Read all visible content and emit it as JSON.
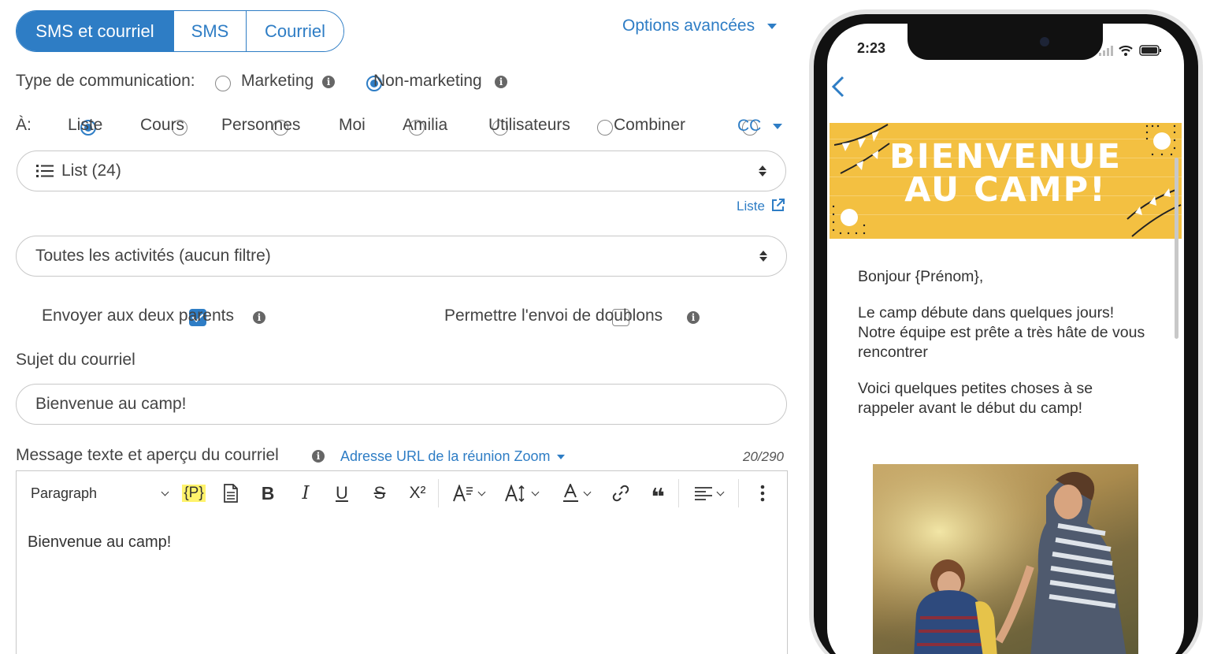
{
  "tabs": [
    "SMS et courriel",
    "SMS",
    "Courriel"
  ],
  "advanced_options_label": "Options avancées",
  "comm_type": {
    "label": "Type de communication:",
    "options": [
      "Marketing",
      "Non-marketing"
    ],
    "selected": "Non-marketing"
  },
  "recipients": {
    "label": "À:",
    "options": [
      "Liste",
      "Cours",
      "Personnes",
      "Moi",
      "Amilia",
      "Utilisateurs",
      "Combiner"
    ],
    "selected": "Liste",
    "cc_label": "CC"
  },
  "list_select": {
    "value": "List (24)"
  },
  "list_link_label": "Liste",
  "activity_select": {
    "value": "Toutes les activités (aucun filtre)"
  },
  "send_both_parents": {
    "label": "Envoyer aux deux parents",
    "checked": true
  },
  "allow_duplicates": {
    "label": "Permettre l'envoi de doublons",
    "checked": false
  },
  "subject": {
    "label": "Sujet du courriel",
    "value": "Bienvenue au camp!"
  },
  "message": {
    "label": "Message texte et aperçu du courriel",
    "zoom_link_label": "Adresse URL de la réunion Zoom",
    "counter": "20/290",
    "body": "Bienvenue au camp!"
  },
  "toolbar": {
    "paragraph_label": "Paragraph",
    "placeholder_token": "{P}",
    "bold": "B",
    "italic": "I",
    "underline": "U",
    "strike": "S",
    "superscript": "X²",
    "quote": "❝"
  },
  "phone": {
    "time": "2:23",
    "banner_line1": "BIENVENUE",
    "banner_line2": "AU CAMP!",
    "greeting": "Bonjour {Prénom},",
    "paragraph1": "Le camp débute dans quelques jours! Notre équipe est prête a très hâte de vous rencontrer",
    "paragraph2": "Voici quelques petites choses à se rappeler avant le début du camp!"
  },
  "colors": {
    "accent": "#2e7dc5",
    "banner": "#f3c041",
    "highlight": "#fff36b"
  }
}
